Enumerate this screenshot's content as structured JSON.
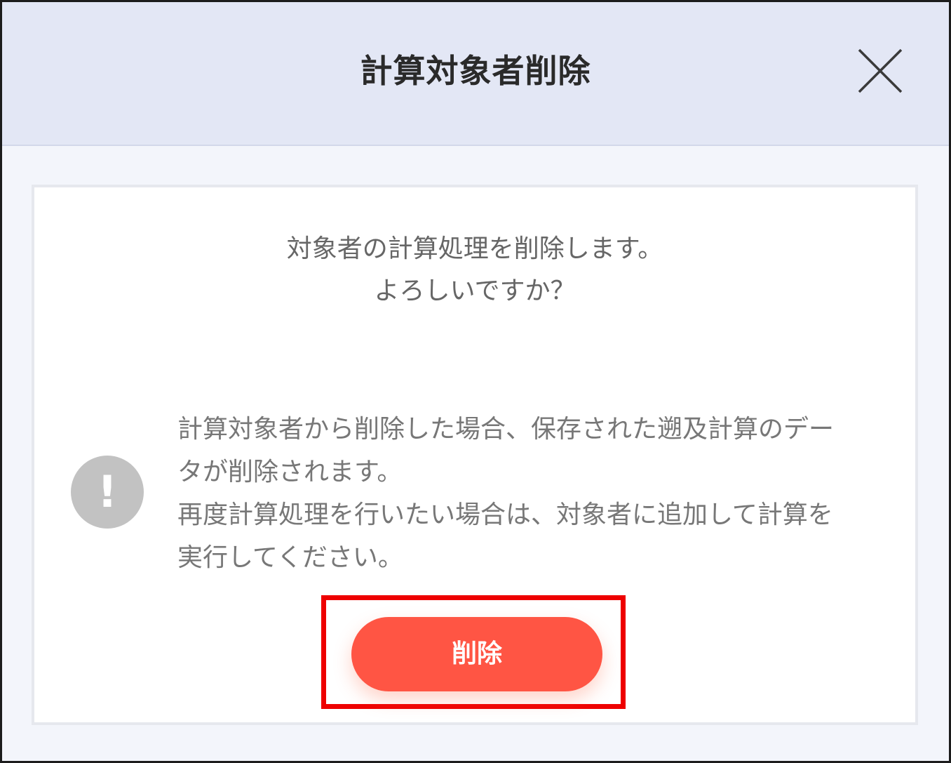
{
  "dialog": {
    "title": "計算対象者削除",
    "close_icon": "close-icon"
  },
  "message": {
    "confirm_line1": "対象者の計算処理を削除します。",
    "confirm_line2": "よろしいですか？"
  },
  "notice": {
    "icon": "exclamation-icon",
    "line1": "計算対象者から削除した場合、保存された遡及計算のデー",
    "line2": "タが削除されます。",
    "line3": "再度計算処理を行いたい場合は、対象者に追加して計算を",
    "line4": "実行してください。"
  },
  "actions": {
    "delete_label": "削除",
    "button_color": "#ff5544",
    "highlight_color": "#ee0000"
  }
}
